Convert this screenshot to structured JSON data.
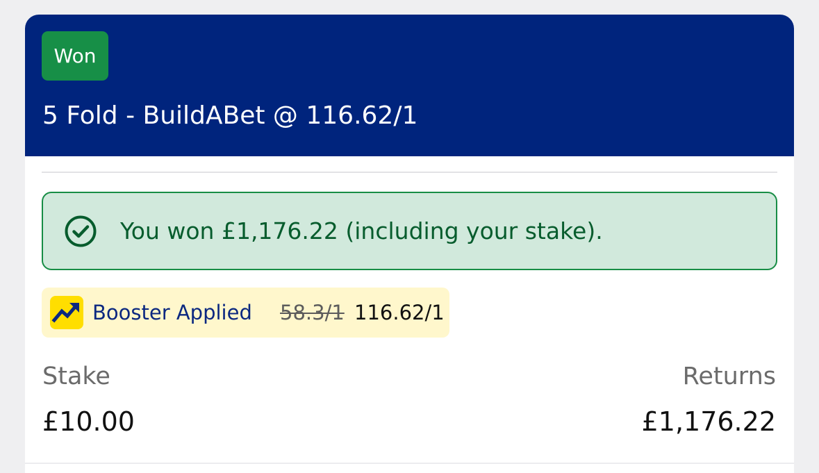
{
  "bet": {
    "status": "Won",
    "title": "5 Fold - BuildABet @ 116.62/1",
    "win_message": "You won £1,176.22 (including your stake).",
    "booster": {
      "label": "Booster Applied",
      "old_odds": "58.3/1",
      "new_odds": "116.62/1",
      "icon": "trending-up-icon"
    },
    "stake": {
      "label": "Stake",
      "value": "£10.00"
    },
    "returns": {
      "label": "Returns",
      "value": "£1,176.22"
    }
  },
  "colors": {
    "header_bg": "#00247d",
    "won_badge": "#178f47",
    "win_banner_bg": "#d1e9dc",
    "win_banner_text": "#075c2d",
    "booster_bg": "#fff7cc",
    "booster_icon_bg": "#ffde00",
    "booster_text": "#0b2880"
  }
}
